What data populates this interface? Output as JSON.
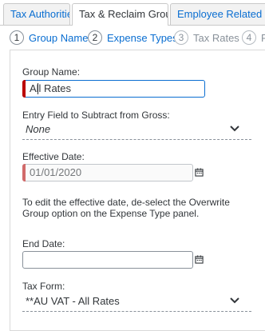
{
  "tabs": [
    {
      "label": "Tax Authorities"
    },
    {
      "label": "Tax & Reclaim Groups"
    },
    {
      "label": "Employee Related Con"
    }
  ],
  "steps": [
    {
      "num": "1",
      "label": "Group Name"
    },
    {
      "num": "2",
      "label": "Expense Types"
    },
    {
      "num": "3",
      "label": "Tax Rates"
    },
    {
      "num": "4",
      "label": "Re"
    }
  ],
  "form": {
    "group_name_label": "Group Name:",
    "group_name_value": "All Rates",
    "entry_field_label": "Entry Field to Subtract from Gross:",
    "entry_field_value": "None",
    "effective_date_label": "Effective Date:",
    "effective_date_value": "01/01/2020",
    "info_text": "To edit the effective date, de-select the Overwrite Group option on the Expense Type panel.",
    "end_date_label": "End Date:",
    "end_date_value": "",
    "tax_form_label": "Tax Form:",
    "tax_form_value": "**AU VAT - All Rates"
  },
  "icons": {
    "dropdown": "chevron-down-icon",
    "calendar": "calendar-icon"
  },
  "colors": {
    "link": "#0a6ed1",
    "required": "#bb0000",
    "text": "#32363a"
  }
}
